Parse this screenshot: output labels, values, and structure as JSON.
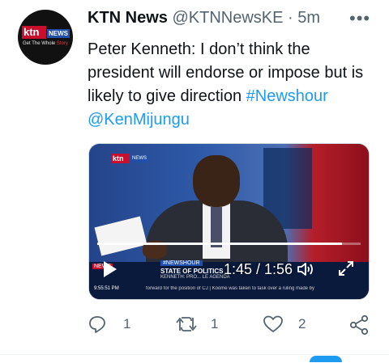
{
  "tweet": {
    "author_name": "KTN News",
    "handle": "@KTNNewsKE",
    "separator": "·",
    "time": "5m",
    "more_label": "•••",
    "text_plain": "Peter Kenneth:  I don’t think the president will endorse or impose but is likely to give direction ",
    "hashtag": "#Newshour",
    "mention": "@KenMijungu"
  },
  "avatar": {
    "logo_text": "ktn",
    "logo_badge": "NEWS",
    "tagline_prefix": "Get The Whole ",
    "tagline_suffix": "Story"
  },
  "video": {
    "elapsed": "1:45",
    "duration": "1:56",
    "time_display": "1:45 / 1:56",
    "progress": 0.93,
    "on_screen": {
      "logo_text": "ktn",
      "logo_badge": "NEWS",
      "ticker_tag": "#NEWSHOUR",
      "channel_label": "NEWS",
      "headline": "STATE OF POLITICS",
      "subline": "KENNETH: PRO... LE AGENDA",
      "clock": "9:55:51 PM",
      "ticker": "forward for the position of CJ | Koome was taken to task over a ruling made by"
    }
  },
  "actions": {
    "reply_count": "1",
    "retweet_count": "1",
    "like_count": "2"
  },
  "icons": {
    "more": "more-horizontal-icon",
    "play": "play-icon",
    "volume": "volume-icon",
    "fullscreen": "fullscreen-icon",
    "reply": "reply-icon",
    "retweet": "retweet-icon",
    "like": "heart-icon",
    "share": "share-icon"
  },
  "colors": {
    "accent": "#1d9bf0",
    "secondary_text": "#536471",
    "primary_text": "#0f1419",
    "brand_red": "#c8102e"
  }
}
